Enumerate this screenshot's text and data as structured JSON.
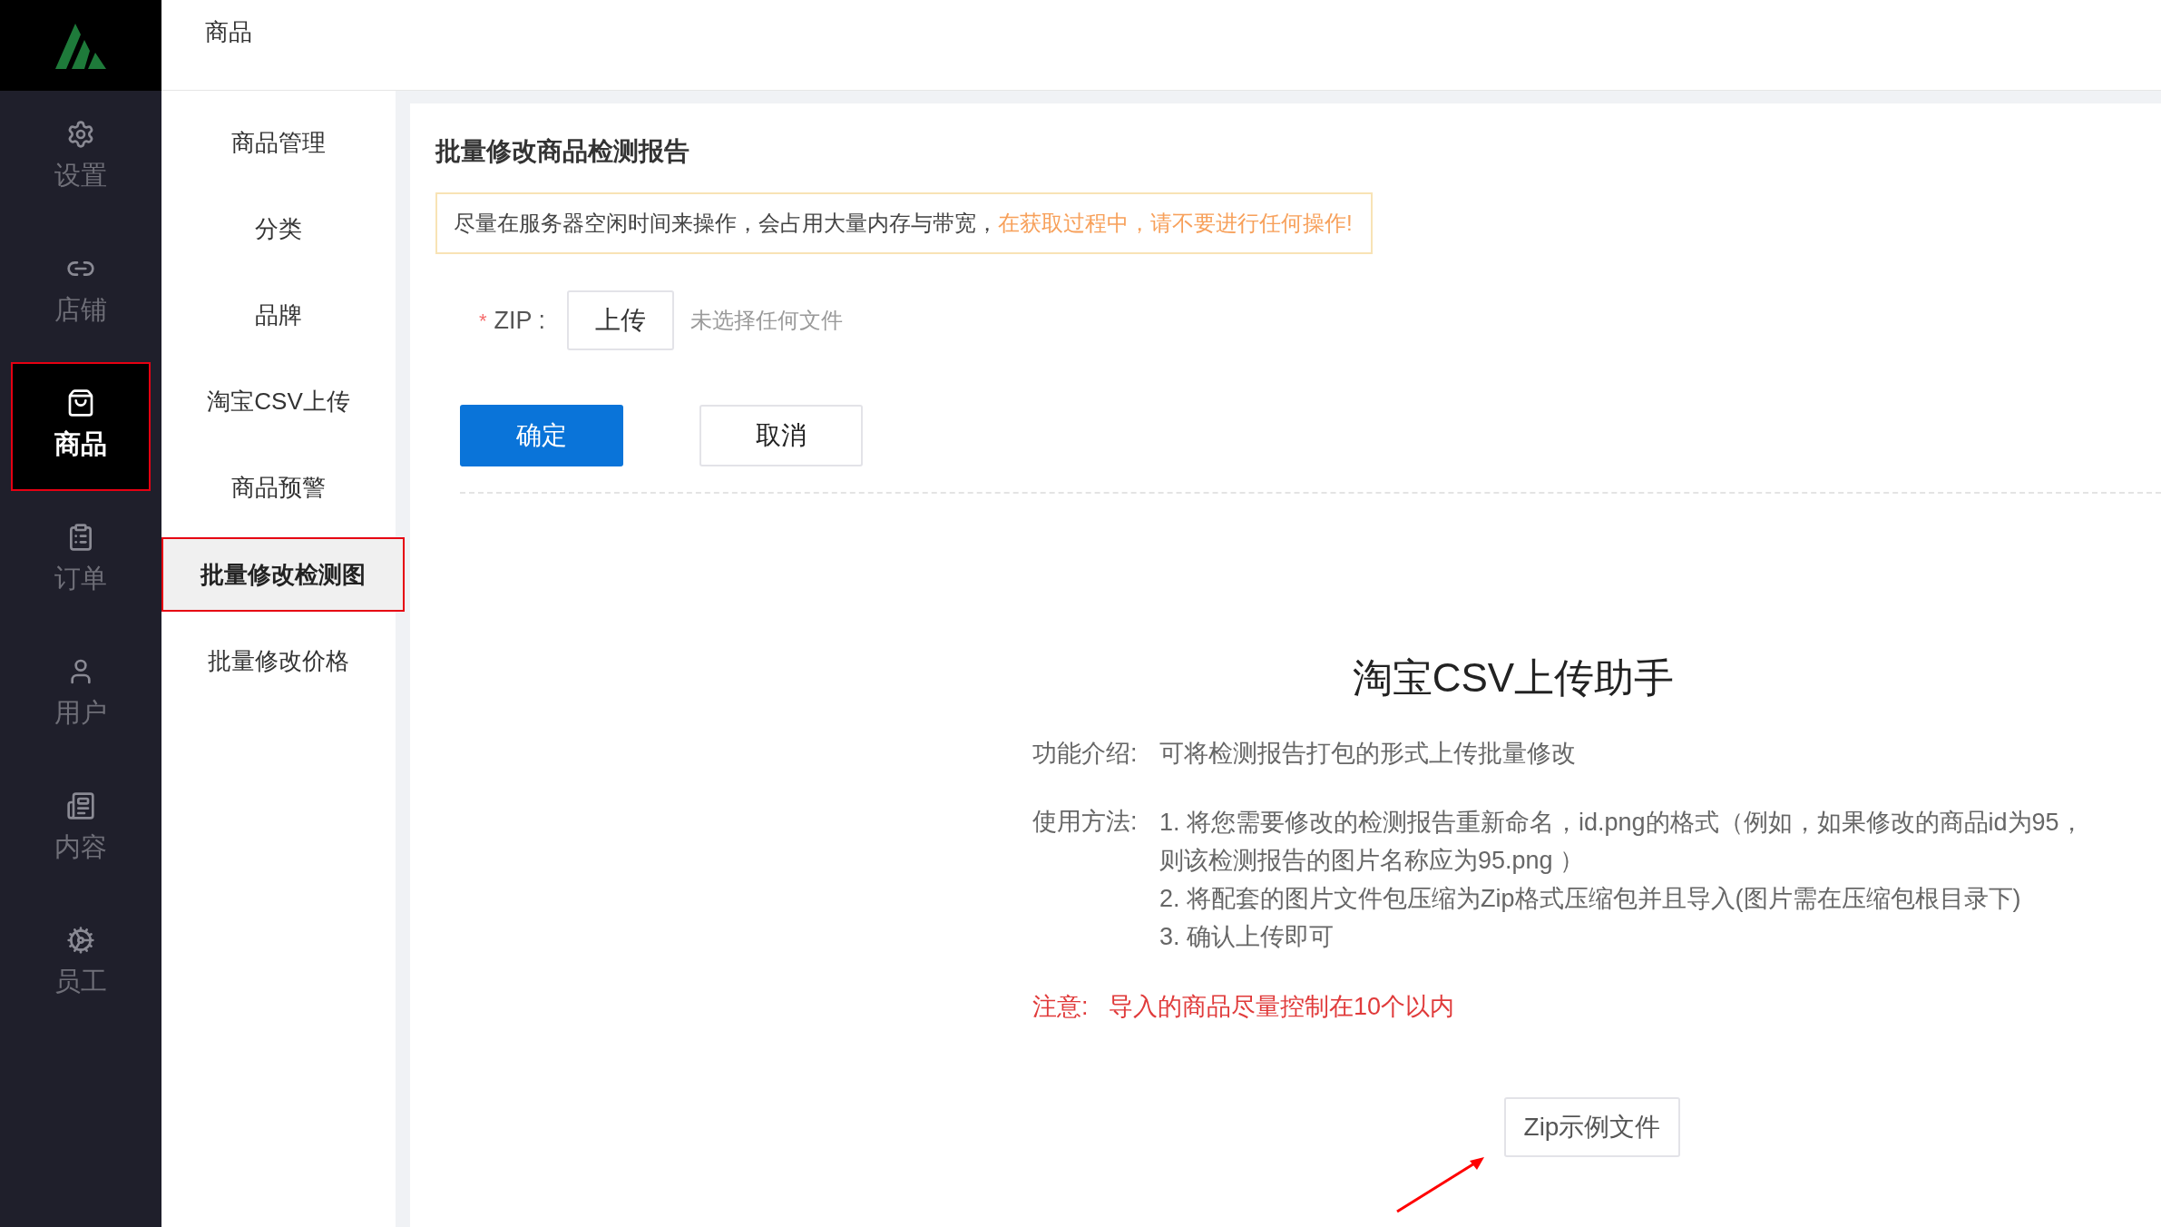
{
  "header": {
    "title": "商品"
  },
  "main_nav": [
    {
      "label": "设置",
      "kind": "settings",
      "selected": false
    },
    {
      "label": "店铺",
      "kind": "link",
      "selected": false
    },
    {
      "label": "商品",
      "kind": "bag",
      "selected": true
    },
    {
      "label": "订单",
      "kind": "clipboard",
      "selected": false
    },
    {
      "label": "用户",
      "kind": "user",
      "selected": false
    },
    {
      "label": "内容",
      "kind": "content",
      "selected": false
    },
    {
      "label": "员工",
      "kind": "gear",
      "selected": false
    }
  ],
  "sub_nav": [
    {
      "label": "商品管理",
      "selected": false
    },
    {
      "label": "分类",
      "selected": false
    },
    {
      "label": "品牌",
      "selected": false
    },
    {
      "label": "淘宝CSV上传",
      "selected": false
    },
    {
      "label": "商品预警",
      "selected": false
    },
    {
      "label": "批量修改检测图",
      "selected": true
    },
    {
      "label": "批量修改价格",
      "selected": false
    }
  ],
  "page_title": "批量修改商品检测报告",
  "alert": {
    "text": "尽量在服务器空闲时间来操作，会占用大量内存与带宽，",
    "highlight": "在获取过程中，请不要进行任何操作!"
  },
  "form": {
    "required_mark": "*",
    "label": "ZIP :",
    "upload_button": "上传",
    "file_status": "未选择任何文件"
  },
  "buttons": {
    "confirm": "确定",
    "cancel": "取消"
  },
  "help": {
    "title": "淘宝CSV上传助手",
    "intro_label": "功能介绍:",
    "intro": "可将检测报告打包的形式上传批量修改",
    "usage_label": "使用方法:",
    "steps": [
      "1. 将您需要修改的检测报告重新命名，id.png的格式（例如，如果修改的商品id为95，则该检测报告的图片名称应为95.png ）",
      "2. 将配套的图片文件包压缩为Zip格式压缩包并且导入(图片需在压缩包根目录下)",
      "3. 确认上传即可"
    ],
    "note_label": "注意:",
    "note": "导入的商品尽量控制在10个以内",
    "example_button": "Zip示例文件"
  }
}
